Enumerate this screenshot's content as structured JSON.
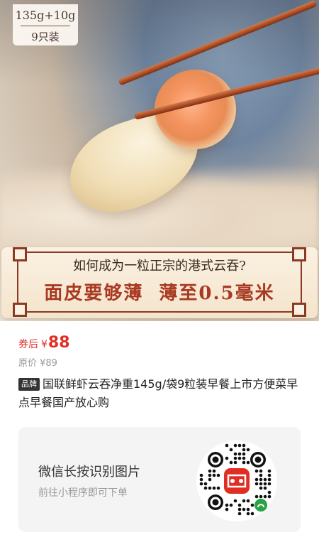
{
  "hero": {
    "badge": {
      "weight": "135g+10g",
      "count": "9只装"
    },
    "banner": {
      "question": "如何成为一粒正宗的港式云吞?",
      "claim_left": "面皮要够薄",
      "claim_right": "薄至0.5毫米"
    }
  },
  "price": {
    "label": "券后",
    "currency": "¥",
    "value": "88",
    "original": "原价 ¥89"
  },
  "product": {
    "brand_tag": "品牌",
    "title": "国联鲜虾云吞净重145g/袋9粒装早餐上市方便菜早点早餐国产放心购"
  },
  "qr_card": {
    "primary": "微信长按识别图片",
    "secondary": "前往小程序即可下单",
    "qr_icon": "pinduoduo-miniprogram-qr"
  },
  "colors": {
    "price_red": "#e02e24",
    "banner_red": "#a83a22",
    "card_bg": "#f4f4f4"
  }
}
